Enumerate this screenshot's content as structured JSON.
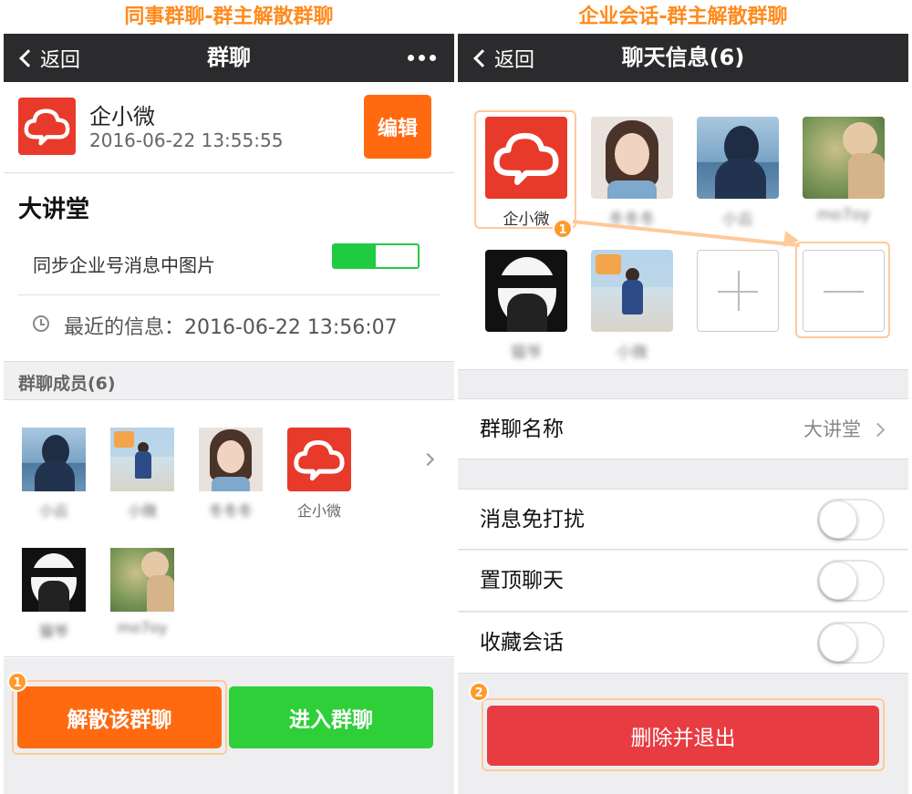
{
  "captions": {
    "left": "同事群聊-群主解散群聊",
    "right": "企业会话-群主解散群聊"
  },
  "left": {
    "nav": {
      "back_label": "返回",
      "title": "群聊",
      "more_icon": "more-dots-icon"
    },
    "header": {
      "name": "企小微",
      "time": "2016-06-22 13:55:55",
      "edit_label": "编辑"
    },
    "group": {
      "name": "大讲堂",
      "sync_label": "同步企业号消息中图片",
      "sync_on": true,
      "recent_label": "最近的信息：2016-06-22 13:56:07"
    },
    "members_header": "群聊成员(6)",
    "members": [
      {
        "label": "小云",
        "blurred": true
      },
      {
        "label": "小微",
        "blurred": true
      },
      {
        "label": "冬冬冬",
        "blurred": true
      },
      {
        "label": "企小微",
        "blurred": false
      },
      {
        "label": "猫爷",
        "blurred": true
      },
      {
        "label": "mo7oy",
        "blurred": true
      }
    ],
    "buttons": {
      "dissolve": "解散该群聊",
      "enter": "进入群聊"
    },
    "badge": "1"
  },
  "right": {
    "nav": {
      "back_label": "返回",
      "title": "聊天信息(6)"
    },
    "members": [
      {
        "label": "企小微",
        "blurred": false
      },
      {
        "label": "冬冬冬",
        "blurred": true
      },
      {
        "label": "小云",
        "blurred": true
      },
      {
        "label": "mo7oy",
        "blurred": true
      },
      {
        "label": "猫爷",
        "blurred": true
      },
      {
        "label": "小微",
        "blurred": true
      }
    ],
    "group_name_label": "群聊名称",
    "group_name_value": "大讲堂",
    "settings": [
      {
        "label": "消息免打扰",
        "on": false
      },
      {
        "label": "置顶聊天",
        "on": false
      },
      {
        "label": "收藏会话",
        "on": false
      }
    ],
    "delete_label": "删除并退出",
    "badge1": "1",
    "badge2": "2"
  },
  "colors": {
    "caption": "#ff8a1c",
    "navbar": "#2b2b2d",
    "orange_button": "#ff6a10",
    "green_button": "#2fcf3a",
    "red_button": "#e83c43",
    "brand_logo": "#e83a2a"
  }
}
